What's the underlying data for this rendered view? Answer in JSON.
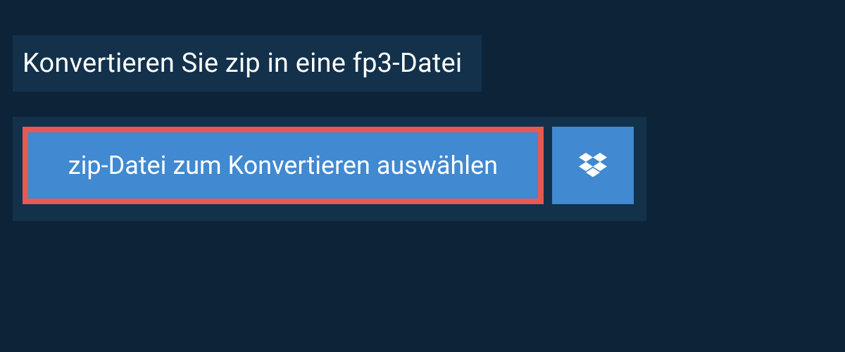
{
  "header": {
    "title": "Konvertieren Sie zip in eine fp3-Datei"
  },
  "actions": {
    "select_file_label": "zip-Datei zum Konvertieren auswählen",
    "dropbox_icon": "dropbox-icon"
  },
  "colors": {
    "background": "#0d2438",
    "panel": "#13314b",
    "primary_button": "#4189d0",
    "highlight_border": "#e65a52"
  }
}
